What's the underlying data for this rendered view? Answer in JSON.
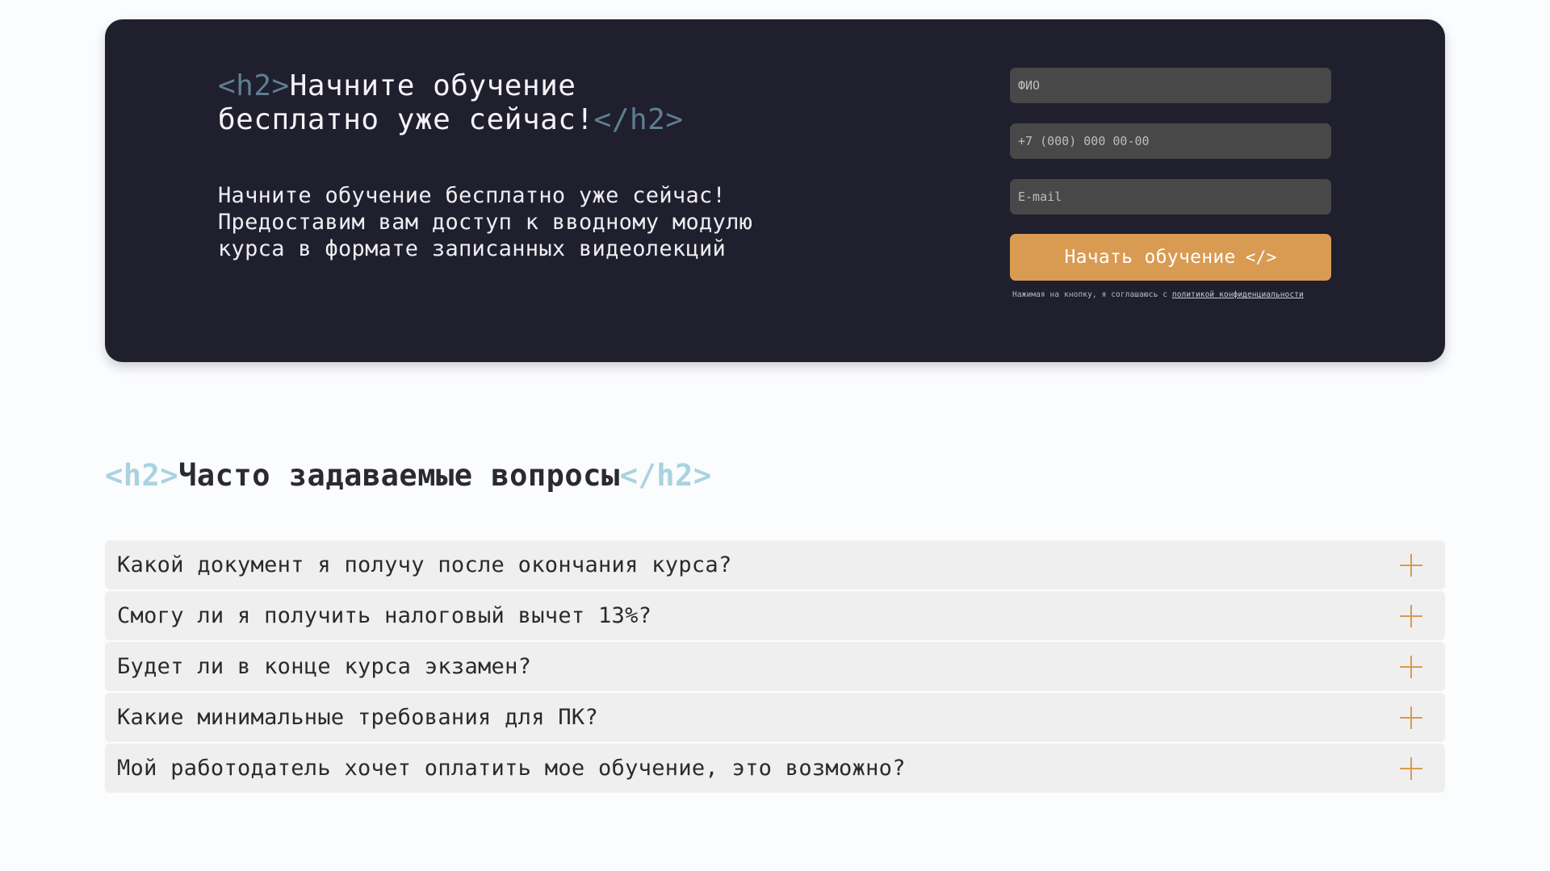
{
  "cta": {
    "title_tag_open": "<h2>",
    "title_text": "Начните обучение бесплатно уже сейчас!",
    "title_tag_close": "</h2>",
    "description": "Начните обучение бесплатно уже сейчас! Предоставим вам доступ к вводному модулю курса в формате записанных видеолекций",
    "form": {
      "name_placeholder": "ФИО",
      "phone_placeholder": "+7 (000) 000 00-00",
      "email_placeholder": "E-mail",
      "submit_label": "Начать обучение",
      "submit_icon": "</>",
      "consent_text": "Нажимая на кнопку, я соглашаюсь с ",
      "consent_link": "политикой конфиденциальности"
    }
  },
  "faq": {
    "heading_tag_open": "<h2>",
    "heading_text": "Часто задаваемые вопросы",
    "heading_tag_close": "</h2>",
    "items": [
      {
        "question": "Какой документ я получу после окончания курса?",
        "icon": "plus-icon"
      },
      {
        "question": "Смогу ли я получить налоговый вычет 13%?",
        "icon": "plus-icon"
      },
      {
        "question": "Будет ли в конце курса экзамен?",
        "icon": "plus-icon"
      },
      {
        "question": "Какие минимальные требования для ПК?",
        "icon": "plus-icon"
      },
      {
        "question": "Мой работодатель хочет оплатить мое обучение, это возможно?",
        "icon": "plus-icon"
      }
    ]
  },
  "colors": {
    "page_bg": "#fbfcfe",
    "card_bg": "#1f1f2e",
    "accent": "#d99a52",
    "input_bg": "#484848",
    "faq_item_bg": "#efefef",
    "tag_dark": "#5e7f92",
    "tag_light": "#a9d3df"
  }
}
